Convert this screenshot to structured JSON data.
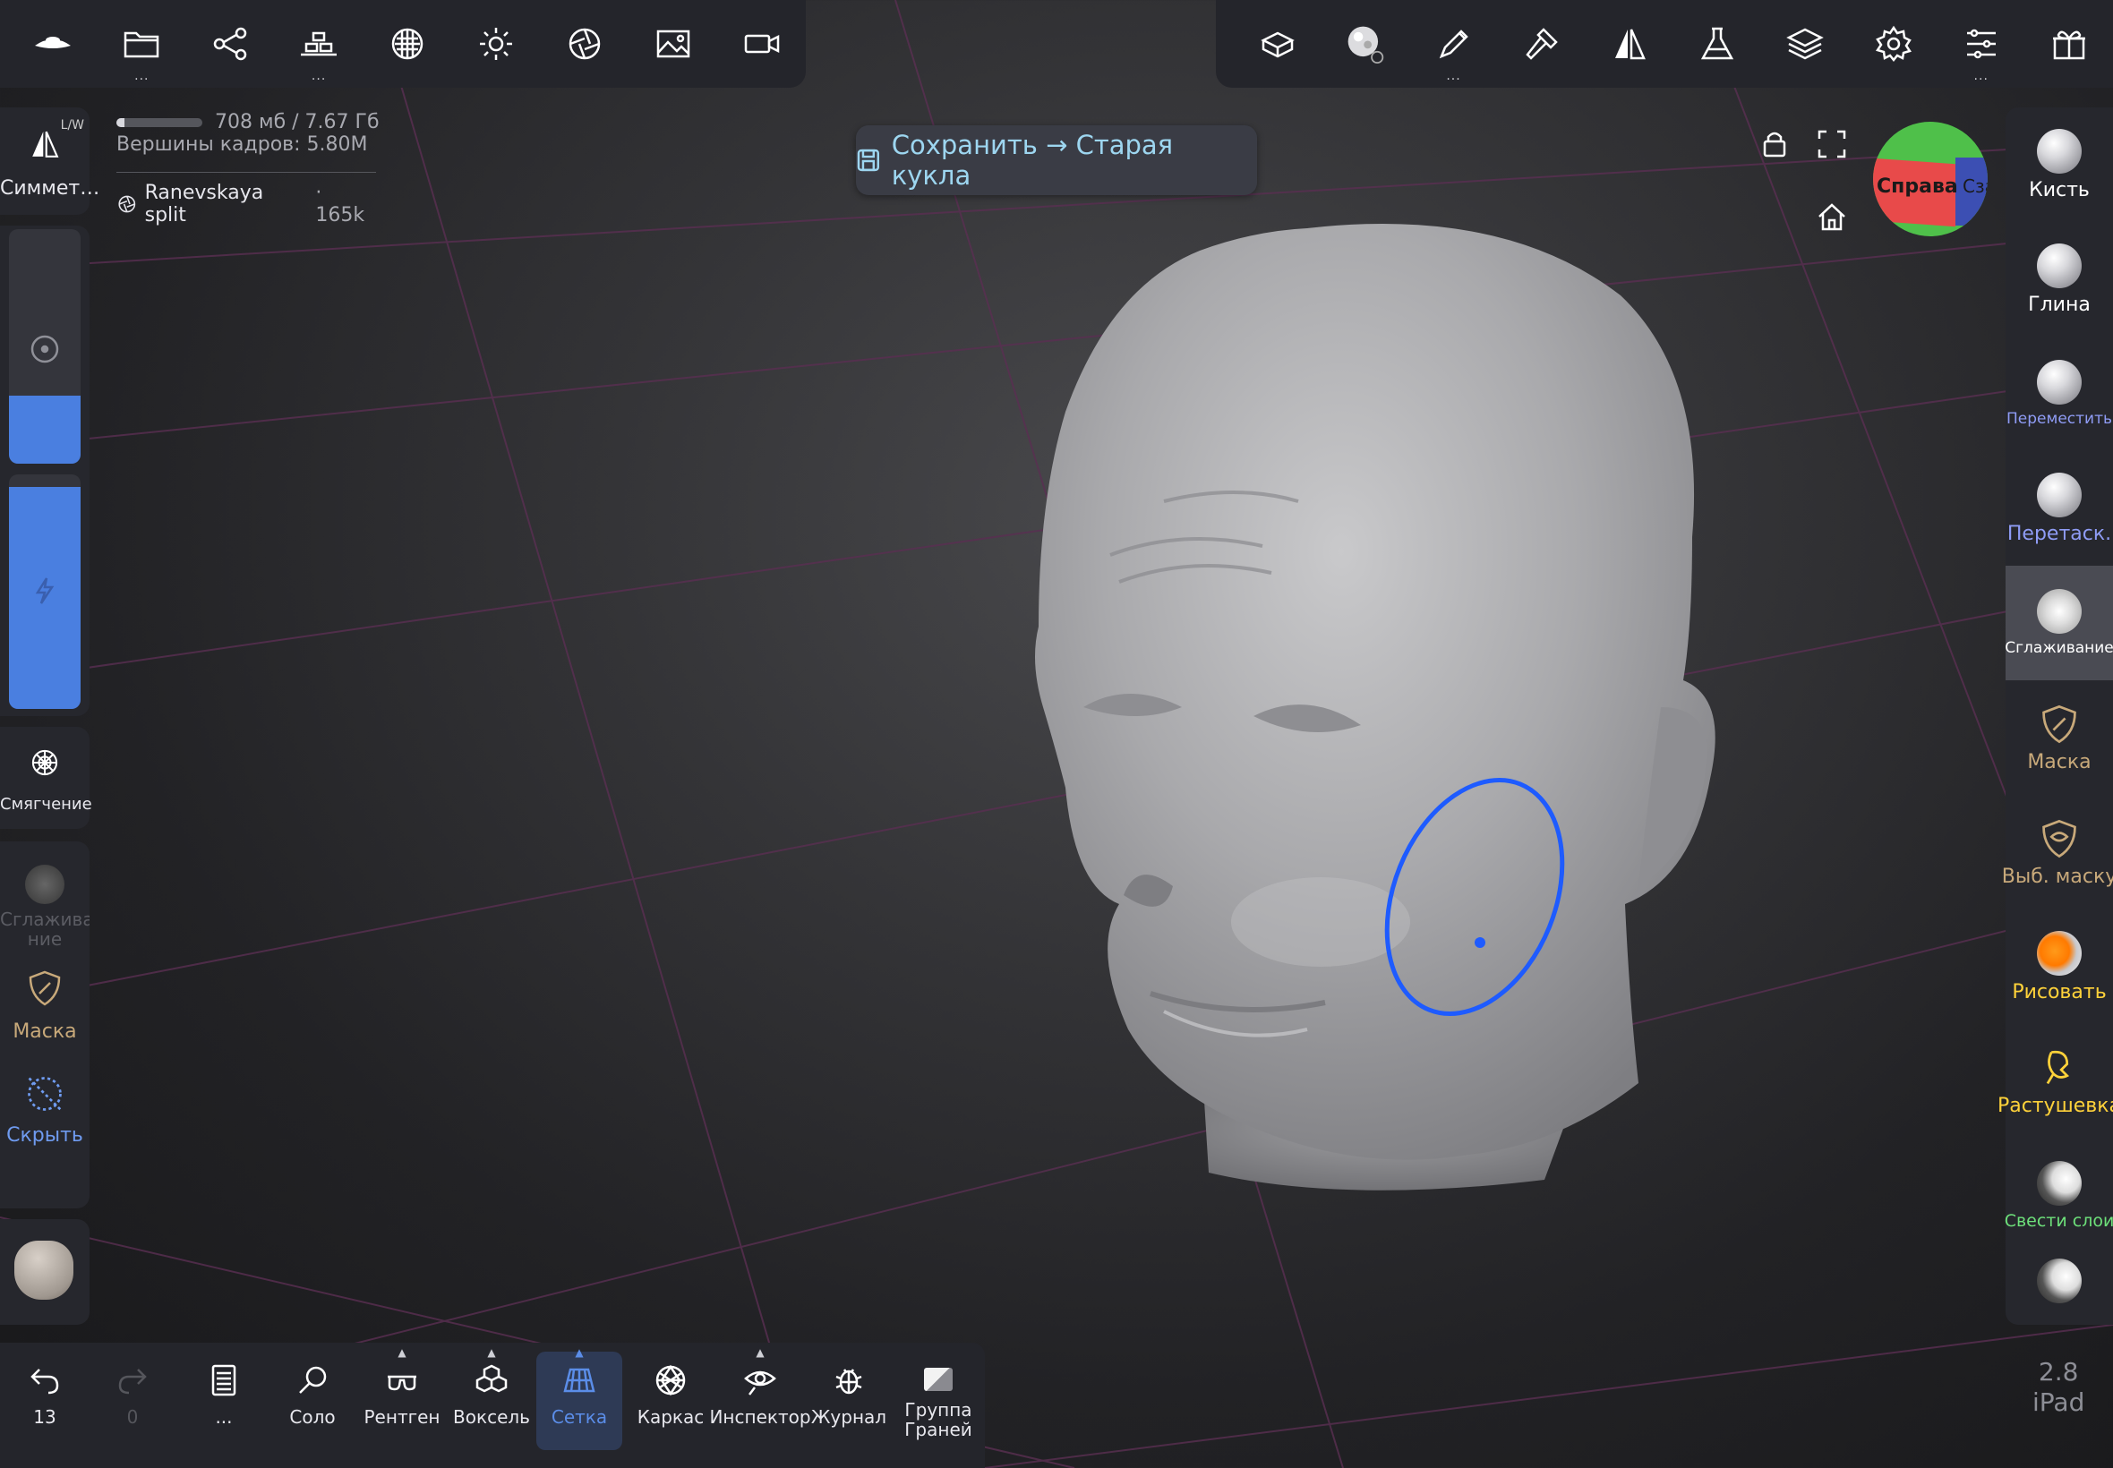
{
  "top_left_icons": [
    "eye-icon",
    "folder-icon",
    "share-icon",
    "scene-icon",
    "material-icon",
    "light-icon",
    "camera-filters-icon",
    "background-image-icon",
    "video-camera-icon"
  ],
  "top_right_icons": [
    "mesh-icon",
    "brush-preview-icon",
    "pencil-icon",
    "hammer-icon",
    "symmetry-icon",
    "flask-icon",
    "layers-icon",
    "settings-icon",
    "sliders-icon",
    "gift-icon"
  ],
  "info": {
    "memory": "708 мб / 7.67 Гб",
    "memory_used_fraction": 0.09,
    "vertices": "Вершины кадров:  5.80M",
    "object_name": "Ranevskaya split",
    "object_count": "· 165k"
  },
  "save_button": {
    "label": "Сохранить → Старая кукла"
  },
  "viewport_icons": [
    "lock-icon",
    "fullscreen-icon",
    "home-icon"
  ],
  "nav_cube": {
    "right_label": "Справа",
    "side_label": "Сза"
  },
  "left_panel": {
    "symmetry_label": "Симмет…",
    "symmetry_sub": "L/W",
    "smoothing_label": "Смягчение",
    "shortcuts": [
      {
        "label": "Сглажива ние"
      },
      {
        "label": "Маска"
      },
      {
        "label": "Скрыть"
      }
    ]
  },
  "right_tools": [
    {
      "label": "Кисть",
      "color": "#ffffff"
    },
    {
      "label": "Глина",
      "color": "#ffffff"
    },
    {
      "label": "Переместить",
      "color": "#8f9cf5"
    },
    {
      "label": "Перетаск.",
      "color": "#8f9cf5"
    },
    {
      "label": "Сглаживание",
      "color": "#ffffff"
    },
    {
      "label": "Маска",
      "color": "#c8a97a"
    },
    {
      "label": "Выб. маску",
      "color": "#c8a97a"
    },
    {
      "label": "Рисовать",
      "color": "#ffd23a"
    },
    {
      "label": "Растушевка",
      "color": "#ffd23a"
    },
    {
      "label": "Свести слои",
      "color": "#6de07a"
    }
  ],
  "bottom_bar": [
    {
      "label": "13"
    },
    {
      "label": "0"
    },
    {
      "label": "..."
    },
    {
      "label": "Соло"
    },
    {
      "label": "Рентген"
    },
    {
      "label": "Воксель"
    },
    {
      "label": "Сетка"
    },
    {
      "label": "Каркас"
    },
    {
      "label": "Инспектор"
    },
    {
      "label": "Журнал"
    },
    {
      "label": "Группа Граней"
    }
  ],
  "version": {
    "number": "2.8",
    "device": "iPad"
  },
  "colors": {
    "accent": "#4a7fe0",
    "brush_ring": "#1e5bff"
  }
}
